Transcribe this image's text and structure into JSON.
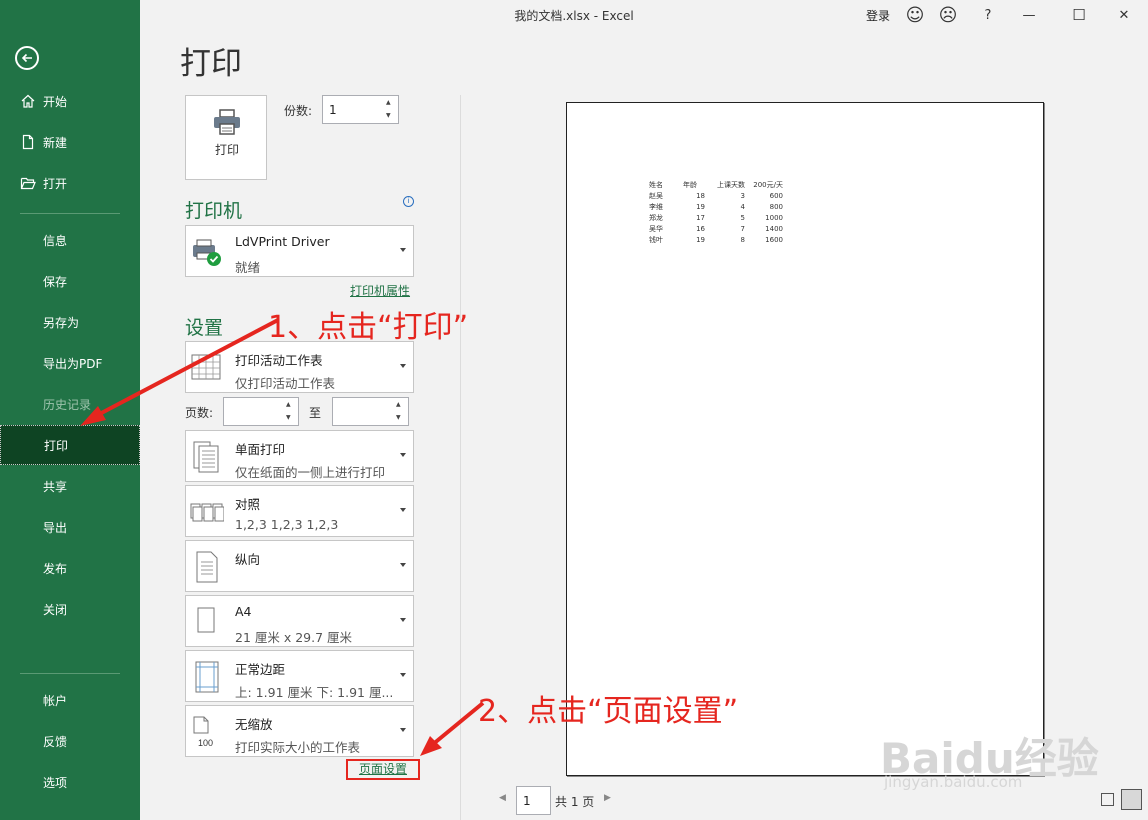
{
  "titlebar": {
    "title": "我的文档.xlsx  -  Excel",
    "login": "登录",
    "help": "?",
    "smile": "☺",
    "frown": "☹",
    "minimize": "—",
    "maximize": "☐",
    "close": "✕"
  },
  "sidebar": {
    "items": [
      {
        "label": "开始"
      },
      {
        "label": "新建"
      },
      {
        "label": "打开"
      },
      {
        "label": "信息"
      },
      {
        "label": "保存"
      },
      {
        "label": "另存为"
      },
      {
        "label": "导出为PDF"
      },
      {
        "label": "历史记录"
      },
      {
        "label": "打印"
      },
      {
        "label": "共享"
      },
      {
        "label": "导出"
      },
      {
        "label": "发布"
      },
      {
        "label": "关闭"
      },
      {
        "label": "帐户"
      },
      {
        "label": "反馈"
      },
      {
        "label": "选项"
      }
    ]
  },
  "print": {
    "page_title": "打印",
    "print_button": "打印",
    "copies_label": "份数:",
    "copies_value": "1",
    "printer_title": "打印机",
    "printer_name": "LdVPrint Driver",
    "printer_status": "就绪",
    "printer_properties": "打印机属性",
    "settings_title": "设置",
    "scope": {
      "line1": "打印活动工作表",
      "line2": "仅打印活动工作表"
    },
    "pages_label": "页数:",
    "pages_to": "至",
    "sides": {
      "line1": "单面打印",
      "line2": "仅在纸面的一侧上进行打印"
    },
    "collate": {
      "line1": "对照",
      "line2": "1,2,3    1,2,3    1,2,3"
    },
    "orientation": {
      "line1": "纵向",
      "line2": ""
    },
    "paper": {
      "line1": "A4",
      "line2": "21 厘米 x 29.7 厘米"
    },
    "margins": {
      "line1": "正常边距",
      "line2": "上: 1.91 厘米 下: 1.91 厘..."
    },
    "scaling": {
      "line1": "无缩放",
      "line2": "打印实际大小的工作表"
    },
    "page_setup": "页面设置"
  },
  "preview": {
    "headers": [
      "姓名",
      "年龄",
      "上课天数",
      "200元/天"
    ],
    "rows": [
      [
        "赵吴",
        "18",
        "3",
        "600"
      ],
      [
        "李维",
        "19",
        "4",
        "800"
      ],
      [
        "郑龙",
        "17",
        "5",
        "1000"
      ],
      [
        "吴华",
        "16",
        "7",
        "1400"
      ],
      [
        "钱叶",
        "19",
        "8",
        "1600"
      ]
    ]
  },
  "pager": {
    "current": "1",
    "total": "共 1 页",
    "prev": "◀",
    "next": "▶"
  },
  "annotations": {
    "step1": "1、点击“打印”",
    "step2": "2、点击“页面设置”",
    "watermark": "Baidu经验",
    "watermark_sub": "jingyan.baidu.com"
  },
  "colors": {
    "sidebar": "#217346",
    "sidebar_active": "#0e4423",
    "accent": "#217346",
    "annotation": "#e5261f"
  }
}
